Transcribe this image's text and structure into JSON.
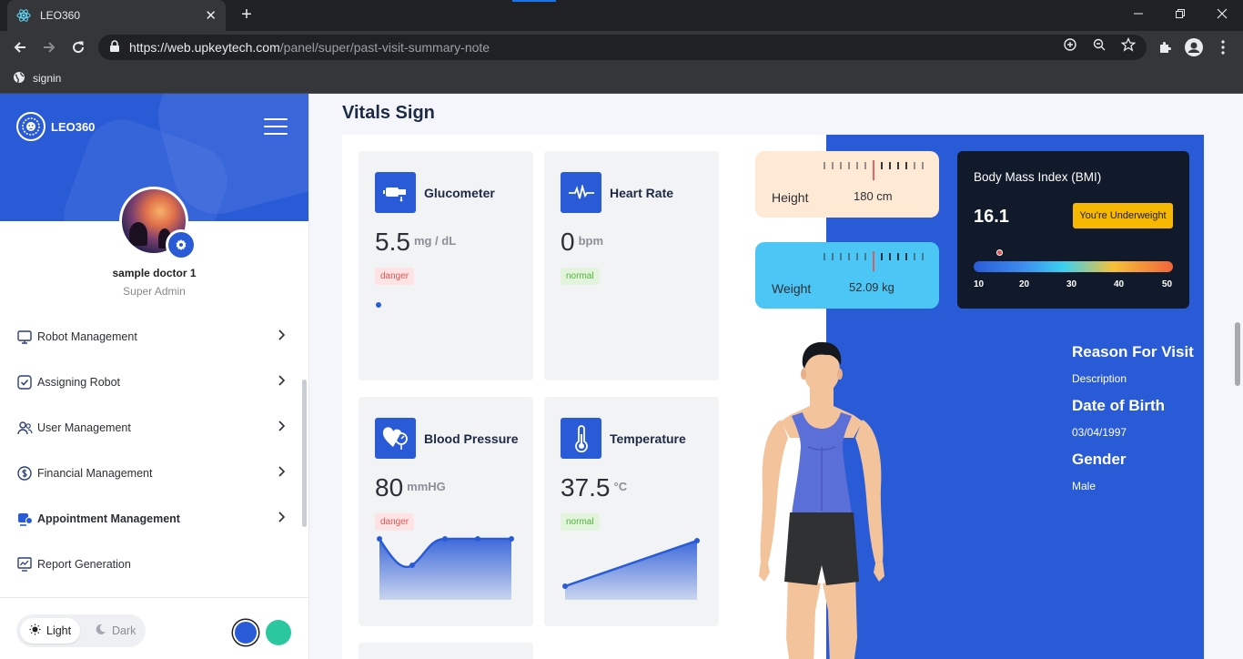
{
  "browser": {
    "tab_title": "LEO360",
    "url_host": "https://web.upkeytech.com",
    "url_path": "/panel/super/past-visit-summary-note",
    "bookmark": "signin"
  },
  "sidebar": {
    "logo_text": "LEO360",
    "user_name": "sample doctor 1",
    "user_role": "Super Admin",
    "menu": [
      {
        "label": "Robot Management",
        "icon": "monitor-icon"
      },
      {
        "label": "Assigning Robot",
        "icon": "check-square-icon"
      },
      {
        "label": "User Management",
        "icon": "users-icon"
      },
      {
        "label": "Financial Management",
        "icon": "dollar-icon"
      },
      {
        "label": "Appointment Management",
        "icon": "calendar-icon"
      },
      {
        "label": "Report Generation",
        "icon": "report-icon"
      }
    ],
    "theme": {
      "light": "Light",
      "dark": "Dark"
    },
    "swatches": [
      "#2a5bd7",
      "#2bc8a0"
    ]
  },
  "main": {
    "title": "Vitals Sign",
    "vitals": [
      {
        "name": "Glucometer",
        "value": "5.5",
        "unit": "mg / dL",
        "status": "danger"
      },
      {
        "name": "Heart Rate",
        "value": "0",
        "unit": "bpm",
        "status": "normal"
      },
      {
        "name": "Blood Pressure",
        "value": "80",
        "unit": "mmHG",
        "status": "danger"
      },
      {
        "name": "Temperature",
        "value": "37.5",
        "unit": "°C",
        "status": "normal"
      }
    ],
    "height": {
      "label": "Height",
      "value": "180 cm"
    },
    "weight": {
      "label": "Weight",
      "value": "52.09 kg"
    },
    "bmi": {
      "title": "Body Mass Index (BMI)",
      "value": "16.1",
      "badge": "You're Underweight",
      "scale": [
        "10",
        "20",
        "30",
        "40",
        "50"
      ]
    },
    "info": [
      {
        "heading": "Reason For Visit",
        "text": "Description"
      },
      {
        "heading": "Date of Birth",
        "text": "03/04/1997"
      },
      {
        "heading": "Gender",
        "text": "Male"
      }
    ]
  },
  "colors": {
    "primary": "#2a5bd7",
    "danger": "#e05555",
    "normal": "#52b13c",
    "bmi_badge": "#f6b800"
  }
}
